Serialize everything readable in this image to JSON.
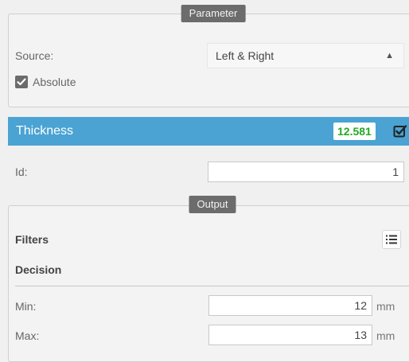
{
  "parameter_section": {
    "title": "Parameter",
    "source_label": "Source:",
    "source_value": "Left & Right",
    "absolute_label": "Absolute",
    "absolute_checked": true
  },
  "measurement": {
    "title": "Thickness",
    "value": "12.581",
    "value_color": "#22aa22",
    "enabled": true
  },
  "id_field": {
    "label": "Id:",
    "value": "1"
  },
  "output_section": {
    "title": "Output",
    "filters_label": "Filters",
    "filters_icon": "list-icon",
    "decision_label": "Decision",
    "min_label": "Min:",
    "min_value": "12",
    "min_unit": "mm",
    "max_label": "Max:",
    "max_value": "13",
    "max_unit": "mm"
  },
  "colors": {
    "header_bg": "#4aa3d3",
    "section_title_bg": "#6c6c6c"
  }
}
